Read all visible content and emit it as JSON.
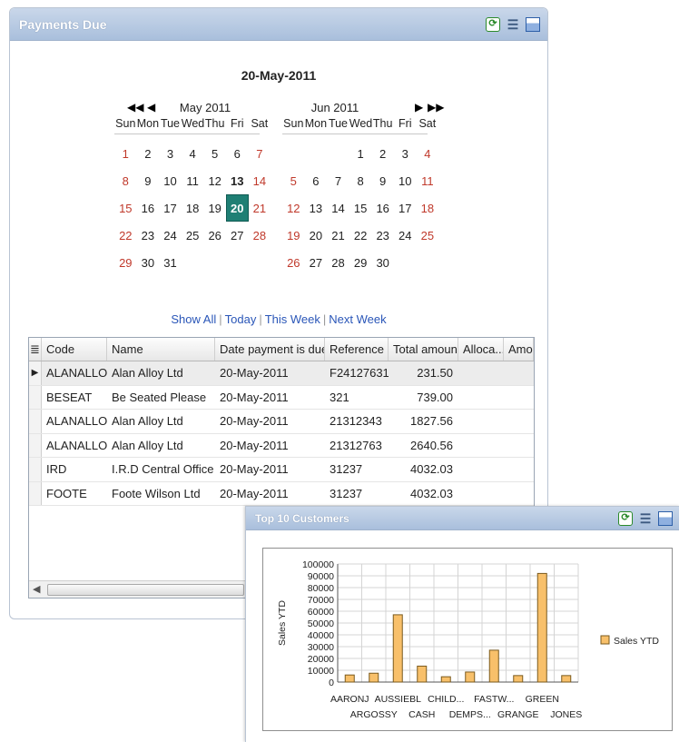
{
  "payments_panel": {
    "title": "Payments Due",
    "selected_date": "20-May-2011",
    "calendars": [
      {
        "month": "May 2011",
        "dow": [
          "Sun",
          "Mon",
          "Tue",
          "Wed",
          "Thu",
          "Fri",
          "Sat"
        ],
        "start_offset": 0,
        "days": 31,
        "today": 13,
        "selected": 20
      },
      {
        "month": "Jun 2011",
        "dow": [
          "Sun",
          "Mon",
          "Tue",
          "Wed",
          "Thu",
          "Fri",
          "Sat"
        ],
        "start_offset": 3,
        "days": 30
      }
    ],
    "quick_links": [
      "Show All",
      "Today",
      "This Week",
      "Next Week"
    ],
    "grid": {
      "columns": [
        "Code",
        "Name",
        "Date payment is due",
        "Reference",
        "Total amount",
        "Alloca...",
        "Amou"
      ],
      "rows": [
        [
          "ALANALLO",
          "Alan Alloy Ltd",
          "20-May-2011",
          "F24127631",
          "231.50"
        ],
        [
          "BESEAT",
          "Be Seated Please",
          "20-May-2011",
          "321",
          "739.00"
        ],
        [
          "ALANALLO",
          "Alan Alloy Ltd",
          "20-May-2011",
          "21312343",
          "1827.56"
        ],
        [
          "ALANALLO",
          "Alan Alloy Ltd",
          "20-May-2011",
          "21312763",
          "2640.56"
        ],
        [
          "IRD",
          "I.R.D Central Office",
          "20-May-2011",
          "31237",
          "4032.03"
        ],
        [
          "FOOTE",
          "Foote Wilson Ltd",
          "20-May-2011",
          "31237",
          "4032.03"
        ]
      ],
      "current_row": 0
    }
  },
  "customers_panel": {
    "title": "Top 10 Customers"
  },
  "chart_data": {
    "type": "bar",
    "categories": [
      "AARONJ",
      "ARGOSSY",
      "AUSSIEBL",
      "CASH",
      "CHILD...",
      "DEMPS...",
      "FASTW...",
      "GRANGE",
      "GREEN",
      "JONES"
    ],
    "series": [
      {
        "name": "Sales YTD",
        "values": [
          6000,
          7500,
          57000,
          13500,
          4500,
          8500,
          27000,
          5500,
          92000,
          5500
        ]
      }
    ],
    "ylabel": "Sales YTD",
    "ylim": [
      0,
      100000
    ],
    "yticks": [
      0,
      10000,
      20000,
      30000,
      40000,
      50000,
      60000,
      70000,
      80000,
      90000,
      100000
    ],
    "grid": true,
    "legend": "right",
    "bar_color": "#f8c06a",
    "bar_stroke": "#7a5a1e"
  },
  "colors": {
    "selected_day": "#1f7f74",
    "weekend": "#c0392b",
    "link": "#2a56b8"
  },
  "icons": [
    "refresh-icon",
    "column-chooser-icon",
    "window-icon"
  ]
}
